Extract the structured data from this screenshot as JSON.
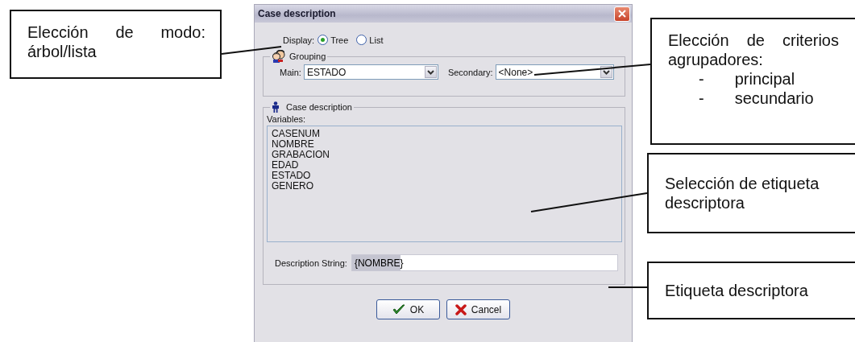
{
  "dialog": {
    "title": "Case description",
    "display": {
      "label": "Display:",
      "options": [
        {
          "label": "Tree",
          "selected": true
        },
        {
          "label": "List",
          "selected": false
        }
      ]
    },
    "grouping": {
      "title": "Grouping",
      "main": {
        "label": "Main:",
        "value": "ESTADO"
      },
      "secondary": {
        "label": "Secondary:",
        "value": "<None>"
      }
    },
    "case_description": {
      "title": "Case description",
      "variables_label": "Variables:",
      "variables": [
        "CASENUM",
        "NOMBRE",
        "GRABACION",
        "EDAD",
        "ESTADO",
        "GENERO"
      ],
      "description_string": {
        "label": "Description String:",
        "value": "{NOMBRE}",
        "text_selected": true
      }
    },
    "buttons": [
      {
        "label": "OK",
        "kind": "ok"
      },
      {
        "label": "Cancel",
        "kind": "cancel"
      }
    ]
  },
  "annotations": [
    {
      "text": "Elección de modo: árbol/lista"
    },
    {
      "text": "Elección de criterios agrupadores:",
      "items": [
        {
          "marker": "-",
          "text": "principal"
        },
        {
          "marker": "-",
          "text": "secundario"
        }
      ]
    },
    {
      "text": "Selección de etiqueta descriptora"
    },
    {
      "text": "Etiqueta descriptora"
    }
  ]
}
